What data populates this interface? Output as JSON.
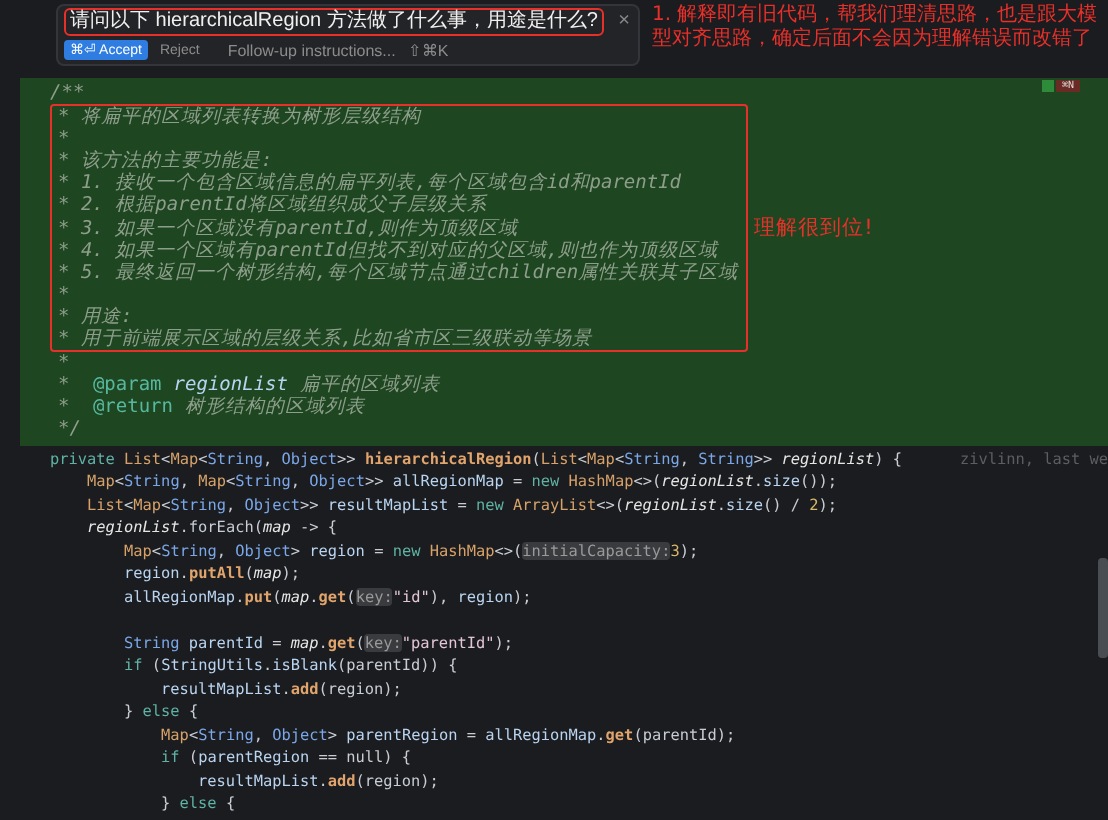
{
  "prompt_popup": {
    "prompt": "请问以下 hierarchicalRegion 方法做了什么事，用途是什么?",
    "accept_button": "⌘⏎ Accept",
    "reject_button": "Reject",
    "followup_placeholder": "Follow-up instructions...",
    "followup_shortcut": "⇧⌘K",
    "close": "×"
  },
  "annotation": "1. 解释即有旧代码，帮我们理清思路，也是跟大模型对齐思路，确定后面不会因为理解错误而改错了",
  "doc_comment": {
    "badge": "⌘N",
    "lines_before": [
      "/**"
    ],
    "highlighted_lines": [
      "* 将扁平的区域列表转换为树形层级结构",
      "*",
      "* 该方法的主要功能是:",
      "* 1. 接收一个包含区域信息的扁平列表,每个区域包含id和parentId",
      "* 2. 根据parentId将区域组织成父子层级关系",
      "* 3. 如果一个区域没有parentId,则作为顶级区域",
      "* 4. 如果一个区域有parentId但找不到对应的父区域,则也作为顶级区域",
      "* 5. 最终返回一个树形结构,每个区域节点通过children属性关联其子区域",
      "*",
      "* 用途:",
      "* 用于前端展示区域的层级关系,比如省市区三级联动等场景"
    ],
    "note": "理解很到位!",
    "lines_after": [
      {
        "kind": "text",
        "text": "*"
      },
      {
        "kind": "tag",
        "tag": "@param",
        "name": "regionList",
        "text": "扁平的区域列表"
      },
      {
        "kind": "tag",
        "tag": "@return",
        "text": "树形结构的区域列表"
      },
      {
        "kind": "text",
        "text": "*/"
      }
    ]
  },
  "code": [
    {
      "kind": "code",
      "blame": "zivlinn, last we",
      "tokens": [
        {
          "text": "private ",
          "kind": "kw"
        },
        {
          "text": "List",
          "kind": "type"
        },
        {
          "text": "<",
          "kind": "plain"
        },
        {
          "text": "Map",
          "kind": "type"
        },
        {
          "text": "<",
          "kind": "plain"
        },
        {
          "text": "String",
          "kind": "type2"
        },
        {
          "text": ", ",
          "kind": "plain"
        },
        {
          "text": "Object",
          "kind": "type2"
        },
        {
          "text": ">> ",
          "kind": "plain"
        },
        {
          "text": "hierarchicalRegion",
          "kind": "fn"
        },
        {
          "text": "(",
          "kind": "plain"
        },
        {
          "text": "List",
          "kind": "type"
        },
        {
          "text": "<",
          "kind": "plain"
        },
        {
          "text": "Map",
          "kind": "type"
        },
        {
          "text": "<",
          "kind": "plain"
        },
        {
          "text": "String",
          "kind": "type2"
        },
        {
          "text": ", ",
          "kind": "plain"
        },
        {
          "text": "String",
          "kind": "type2"
        },
        {
          "text": ">> ",
          "kind": "plain"
        },
        {
          "text": "regionList",
          "kind": "param"
        },
        {
          "text": ") {",
          "kind": "plain"
        }
      ]
    },
    {
      "kind": "code",
      "tokens": [
        {
          "text": "    Map",
          "kind": "type"
        },
        {
          "text": "<",
          "kind": "plain"
        },
        {
          "text": "String",
          "kind": "type2"
        },
        {
          "text": ", ",
          "kind": "plain"
        },
        {
          "text": "Map",
          "kind": "type"
        },
        {
          "text": "<",
          "kind": "plain"
        },
        {
          "text": "String",
          "kind": "type2"
        },
        {
          "text": ", ",
          "kind": "plain"
        },
        {
          "text": "Object",
          "kind": "type2"
        },
        {
          "text": ">> ",
          "kind": "plain"
        },
        {
          "text": "allRegionMap",
          "kind": "var"
        },
        {
          "text": " = ",
          "kind": "plain"
        },
        {
          "text": "new ",
          "kind": "kw"
        },
        {
          "text": "HashMap",
          "kind": "type"
        },
        {
          "text": "<>(",
          "kind": "plain"
        },
        {
          "text": "regionList",
          "kind": "param"
        },
        {
          "text": ".",
          "kind": "plain"
        },
        {
          "text": "size",
          "kind": "var"
        },
        {
          "text": "());",
          "kind": "plain"
        }
      ]
    },
    {
      "kind": "code",
      "tokens": [
        {
          "text": "    List",
          "kind": "type"
        },
        {
          "text": "<",
          "kind": "plain"
        },
        {
          "text": "Map",
          "kind": "type"
        },
        {
          "text": "<",
          "kind": "plain"
        },
        {
          "text": "String",
          "kind": "type2"
        },
        {
          "text": ", ",
          "kind": "plain"
        },
        {
          "text": "Object",
          "kind": "type2"
        },
        {
          "text": ">> ",
          "kind": "plain"
        },
        {
          "text": "resultMapList",
          "kind": "var"
        },
        {
          "text": " = ",
          "kind": "plain"
        },
        {
          "text": "new ",
          "kind": "kw"
        },
        {
          "text": "ArrayList",
          "kind": "type"
        },
        {
          "text": "<>(",
          "kind": "plain"
        },
        {
          "text": "regionList",
          "kind": "param"
        },
        {
          "text": ".",
          "kind": "plain"
        },
        {
          "text": "size",
          "kind": "var"
        },
        {
          "text": "() / ",
          "kind": "plain"
        },
        {
          "text": "2",
          "kind": "num"
        },
        {
          "text": ");",
          "kind": "plain"
        }
      ]
    },
    {
      "kind": "code",
      "tokens": [
        {
          "text": "    regionList",
          "kind": "param"
        },
        {
          "text": ".forEach(",
          "kind": "plain"
        },
        {
          "text": "map",
          "kind": "param"
        },
        {
          "text": " -> {",
          "kind": "plain"
        }
      ]
    },
    {
      "kind": "code",
      "tokens": [
        {
          "text": "        Map",
          "kind": "type"
        },
        {
          "text": "<",
          "kind": "plain"
        },
        {
          "text": "String",
          "kind": "type2"
        },
        {
          "text": ", ",
          "kind": "plain"
        },
        {
          "text": "Object",
          "kind": "type2"
        },
        {
          "text": "> ",
          "kind": "plain"
        },
        {
          "text": "region",
          "kind": "var"
        },
        {
          "text": " = ",
          "kind": "plain"
        },
        {
          "text": "new ",
          "kind": "kw"
        },
        {
          "text": "HashMap",
          "kind": "type"
        },
        {
          "text": "<>(",
          "kind": "plain"
        },
        {
          "text": "initialCapacity:",
          "kind": "hint"
        },
        {
          "text": "3",
          "kind": "num"
        },
        {
          "text": ");",
          "kind": "plain"
        }
      ]
    },
    {
      "kind": "code",
      "tokens": [
        {
          "text": "        region",
          "kind": "var"
        },
        {
          "text": ".",
          "kind": "plain"
        },
        {
          "text": "putAll",
          "kind": "fn"
        },
        {
          "text": "(",
          "kind": "plain"
        },
        {
          "text": "map",
          "kind": "param"
        },
        {
          "text": ");",
          "kind": "plain"
        }
      ]
    },
    {
      "kind": "code",
      "tokens": [
        {
          "text": "        allRegionMap",
          "kind": "var"
        },
        {
          "text": ".",
          "kind": "plain"
        },
        {
          "text": "put",
          "kind": "fn"
        },
        {
          "text": "(",
          "kind": "plain"
        },
        {
          "text": "map",
          "kind": "param"
        },
        {
          "text": ".",
          "kind": "plain"
        },
        {
          "text": "get",
          "kind": "fn"
        },
        {
          "text": "(",
          "kind": "plain"
        },
        {
          "text": "key:",
          "kind": "hint"
        },
        {
          "text": "\"id\"",
          "kind": "str"
        },
        {
          "text": "), ",
          "kind": "plain"
        },
        {
          "text": "region",
          "kind": "var"
        },
        {
          "text": ");",
          "kind": "plain"
        }
      ]
    },
    {
      "kind": "blank"
    },
    {
      "kind": "code",
      "tokens": [
        {
          "text": "        String",
          "kind": "type2"
        },
        {
          "text": " parentId",
          "kind": "var"
        },
        {
          "text": " = ",
          "kind": "plain"
        },
        {
          "text": "map",
          "kind": "param"
        },
        {
          "text": ".",
          "kind": "plain"
        },
        {
          "text": "get",
          "kind": "fn"
        },
        {
          "text": "(",
          "kind": "plain"
        },
        {
          "text": "key:",
          "kind": "hint"
        },
        {
          "text": "\"parentId\"",
          "kind": "str"
        },
        {
          "text": ");",
          "kind": "plain"
        }
      ]
    },
    {
      "kind": "code",
      "tokens": [
        {
          "text": "        if",
          "kind": "kw"
        },
        {
          "text": " (",
          "kind": "plain"
        },
        {
          "text": "StringUtils",
          "kind": "var"
        },
        {
          "text": ".",
          "kind": "plain"
        },
        {
          "text": "isBlank",
          "kind": "var"
        },
        {
          "text": "(parentId)) {",
          "kind": "plain"
        }
      ]
    },
    {
      "kind": "code",
      "tokens": [
        {
          "text": "            resultMapList",
          "kind": "var"
        },
        {
          "text": ".",
          "kind": "plain"
        },
        {
          "text": "add",
          "kind": "fn"
        },
        {
          "text": "(region);",
          "kind": "plain"
        }
      ]
    },
    {
      "kind": "code",
      "tokens": [
        {
          "text": "        } ",
          "kind": "plain"
        },
        {
          "text": "else",
          "kind": "kw"
        },
        {
          "text": " {",
          "kind": "plain"
        }
      ]
    },
    {
      "kind": "code",
      "tokens": [
        {
          "text": "            Map",
          "kind": "type"
        },
        {
          "text": "<",
          "kind": "plain"
        },
        {
          "text": "String",
          "kind": "type2"
        },
        {
          "text": ", ",
          "kind": "plain"
        },
        {
          "text": "Object",
          "kind": "type2"
        },
        {
          "text": "> ",
          "kind": "plain"
        },
        {
          "text": "parentRegion",
          "kind": "var"
        },
        {
          "text": " = ",
          "kind": "plain"
        },
        {
          "text": "allRegionMap",
          "kind": "var"
        },
        {
          "text": ".",
          "kind": "plain"
        },
        {
          "text": "get",
          "kind": "fn"
        },
        {
          "text": "(parentId);",
          "kind": "plain"
        }
      ]
    },
    {
      "kind": "code",
      "tokens": [
        {
          "text": "            if",
          "kind": "kw"
        },
        {
          "text": " (",
          "kind": "plain"
        },
        {
          "text": "parentRegion",
          "kind": "var"
        },
        {
          "text": " == null) {",
          "kind": "plain"
        }
      ]
    },
    {
      "kind": "code",
      "tokens": [
        {
          "text": "                resultMapList",
          "kind": "var"
        },
        {
          "text": ".",
          "kind": "plain"
        },
        {
          "text": "add",
          "kind": "fn"
        },
        {
          "text": "(region);",
          "kind": "plain"
        }
      ]
    },
    {
      "kind": "code",
      "tokens": [
        {
          "text": "            } ",
          "kind": "plain"
        },
        {
          "text": "else",
          "kind": "kw"
        },
        {
          "text": " {",
          "kind": "plain"
        }
      ]
    }
  ]
}
